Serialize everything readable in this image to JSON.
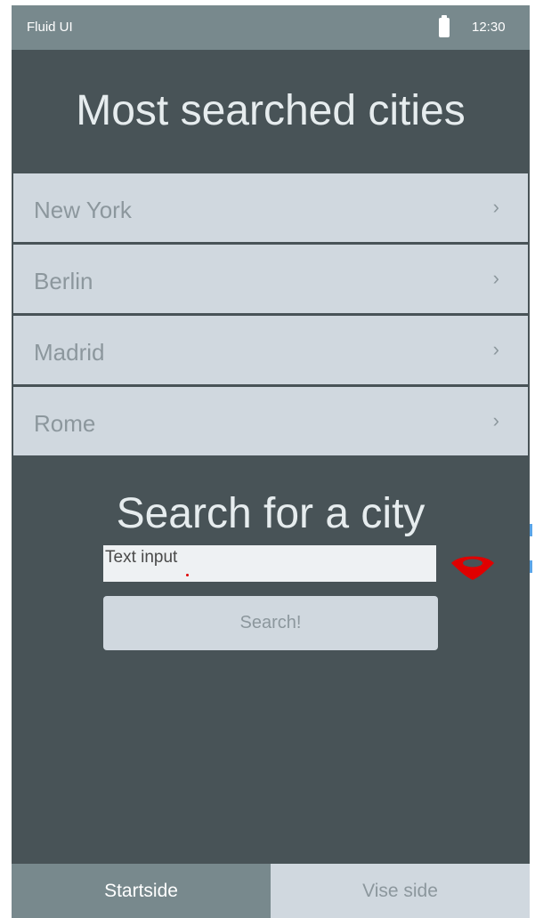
{
  "status_bar": {
    "app_name": "Fluid UI",
    "time": "12:30",
    "battery_icon": "battery-icon"
  },
  "header": {
    "title": "Most searched cities"
  },
  "cities": [
    {
      "label": "New York"
    },
    {
      "label": "Berlin"
    },
    {
      "label": "Madrid"
    },
    {
      "label": "Rome"
    }
  ],
  "chevron": "›",
  "search": {
    "heading": "Search for a city",
    "placeholder": "Text input",
    "button_label": "Search!",
    "eye_icon": "eye-icon"
  },
  "tabs": {
    "start": "Startside",
    "vise": "Vise side"
  },
  "colors": {
    "background": "#485357",
    "status_bar": "#78898d",
    "list_item": "#d0d8df",
    "eye_icon": "#e00000"
  }
}
